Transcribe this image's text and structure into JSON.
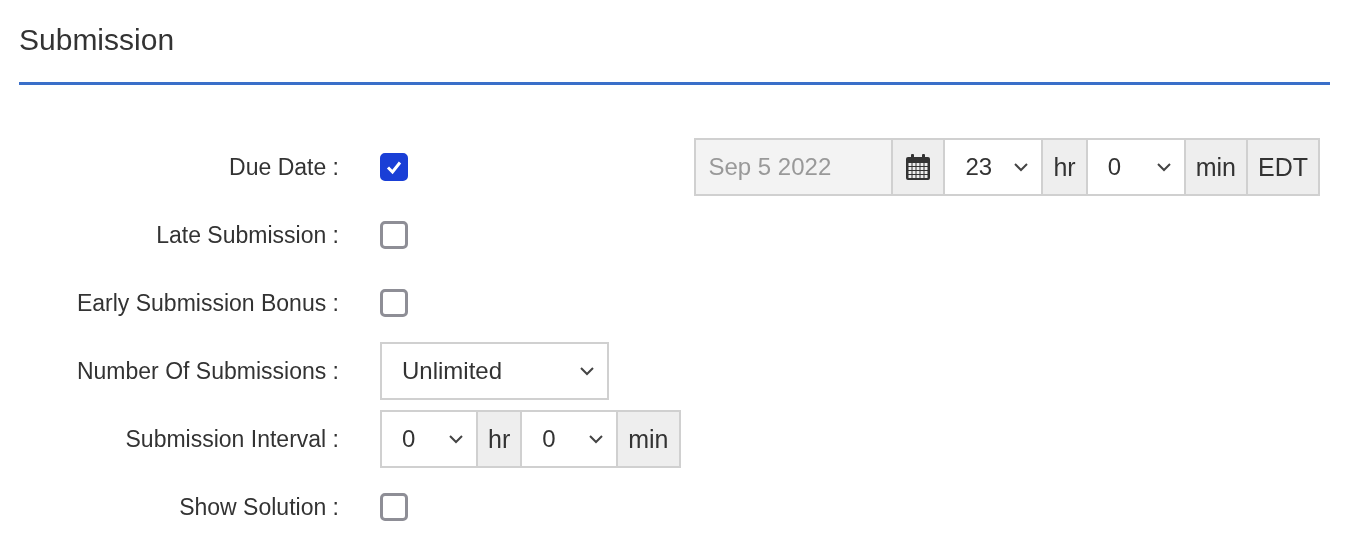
{
  "section": {
    "title": "Submission"
  },
  "rows": [
    {
      "kind": "checkbox",
      "label": "Due Date :",
      "checked": true,
      "date": {
        "value": "Sep 5 2022",
        "hour": "23",
        "hour_unit": "hr",
        "minute": "0",
        "minute_unit": "min",
        "zone": "EDT"
      }
    },
    {
      "kind": "checkbox",
      "label": "Late Submission :",
      "checked": false
    },
    {
      "kind": "checkbox",
      "label": "Early Submission Bonus :",
      "checked": false
    },
    {
      "kind": "select",
      "label": "Number Of Submissions :",
      "value": "Unlimited"
    },
    {
      "kind": "interval",
      "label": "Submission Interval :",
      "hour": "0",
      "hour_unit": "hr",
      "minute": "0",
      "minute_unit": "min"
    },
    {
      "kind": "checkbox",
      "label": "Show Solution :",
      "checked": false
    }
  ]
}
